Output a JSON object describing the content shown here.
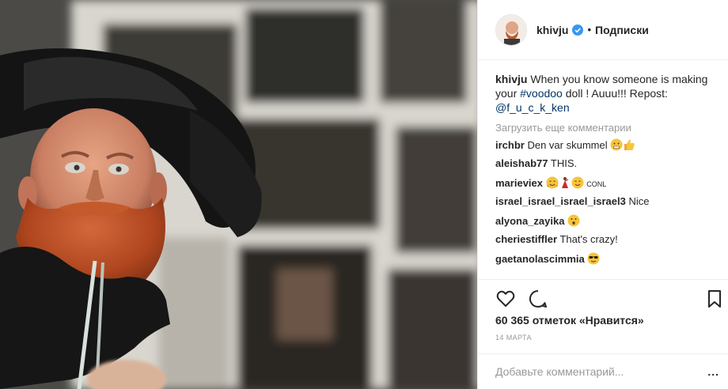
{
  "post": {
    "username": "khivju",
    "separator": "•",
    "follow_label": "Подписки",
    "caption": {
      "username": "khivju",
      "text_before": "When you know someone is making your ",
      "hashtag": "#voodoo",
      "text_after": " doll ! Auuu!!! Repost: ",
      "mention": "@f_u_c_k_ken"
    },
    "load_more": "Загрузить еще комментарии",
    "comments": [
      {
        "username": "irchbr",
        "text": "Den var skummel",
        "emoji": [
          "scared-emoji",
          "thumbs-up-emoji"
        ]
      },
      {
        "username": "aleishab77",
        "text": "THIS.",
        "emoji": []
      },
      {
        "username": "marieviex",
        "text": "",
        "emoji": [
          "hug-emoji",
          "dancer-emoji",
          "smile-emoji"
        ],
        "suffix": "CONL"
      },
      {
        "username": "israel_israel_israel_israel3",
        "text": "Nice",
        "emoji": []
      },
      {
        "username": "alyona_zayika",
        "text": "",
        "emoji": [
          "wow-emoji"
        ]
      },
      {
        "username": "cheriestiffler",
        "text": "That's crazy!",
        "emoji": []
      },
      {
        "username": "gaetanolascimmia",
        "text": "",
        "emoji": [
          "sunglasses-emoji"
        ]
      }
    ],
    "likes": "60 365 отметок «Нравится»",
    "date": "14 марта",
    "comment_placeholder": "Добавьте комментарий...",
    "more_label": "..."
  },
  "colors": {
    "link": "#003569",
    "verified": "#3897f0",
    "muted": "#999999",
    "text": "#262626"
  }
}
